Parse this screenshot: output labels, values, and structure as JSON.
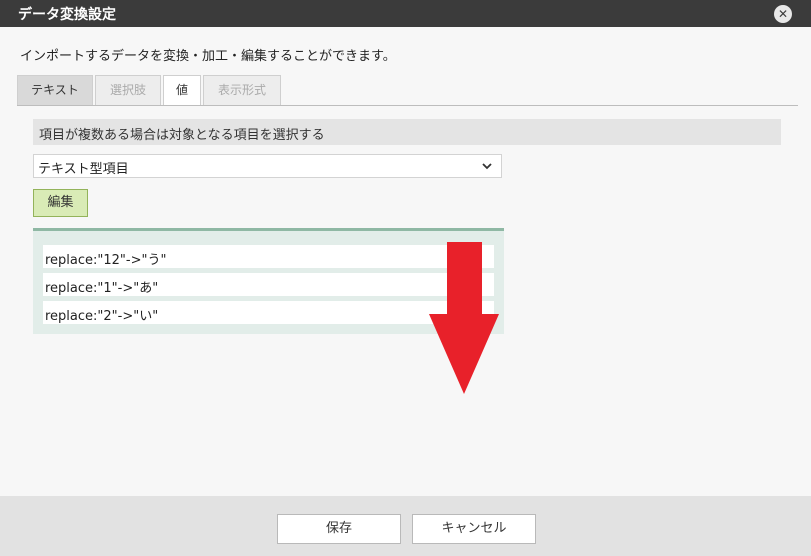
{
  "dialog": {
    "title": "データ変換設定",
    "close_symbol": "✕",
    "description": "インポートするデータを変換・加工・編集することができます。"
  },
  "tabs": [
    {
      "label": "テキスト",
      "state": "normal"
    },
    {
      "label": "選択肢",
      "state": "disabled"
    },
    {
      "label": "値",
      "state": "active"
    },
    {
      "label": "表示形式",
      "state": "disabled"
    }
  ],
  "hint": "項目が複数ある場合は対象となる項目を選択する",
  "select": {
    "value": "テキスト型項目",
    "icon": "chevron-down-icon"
  },
  "edit_button": "編集",
  "rules": [
    "replace:\"12\"->\"う\"",
    "replace:\"1\"->\"あ\"",
    "replace:\"2\"->\"い\""
  ],
  "annotation": {
    "icon": "red-down-arrow-icon",
    "color": "#e8212a"
  },
  "footer": {
    "save_label": "保存",
    "cancel_label": "キャンセル"
  },
  "colors": {
    "titlebar": "#3b3b3b",
    "edit_button_bg": "#d9ebb6",
    "list_panel_bg": "#e2ede9",
    "list_panel_border": "#8fb8a4"
  }
}
